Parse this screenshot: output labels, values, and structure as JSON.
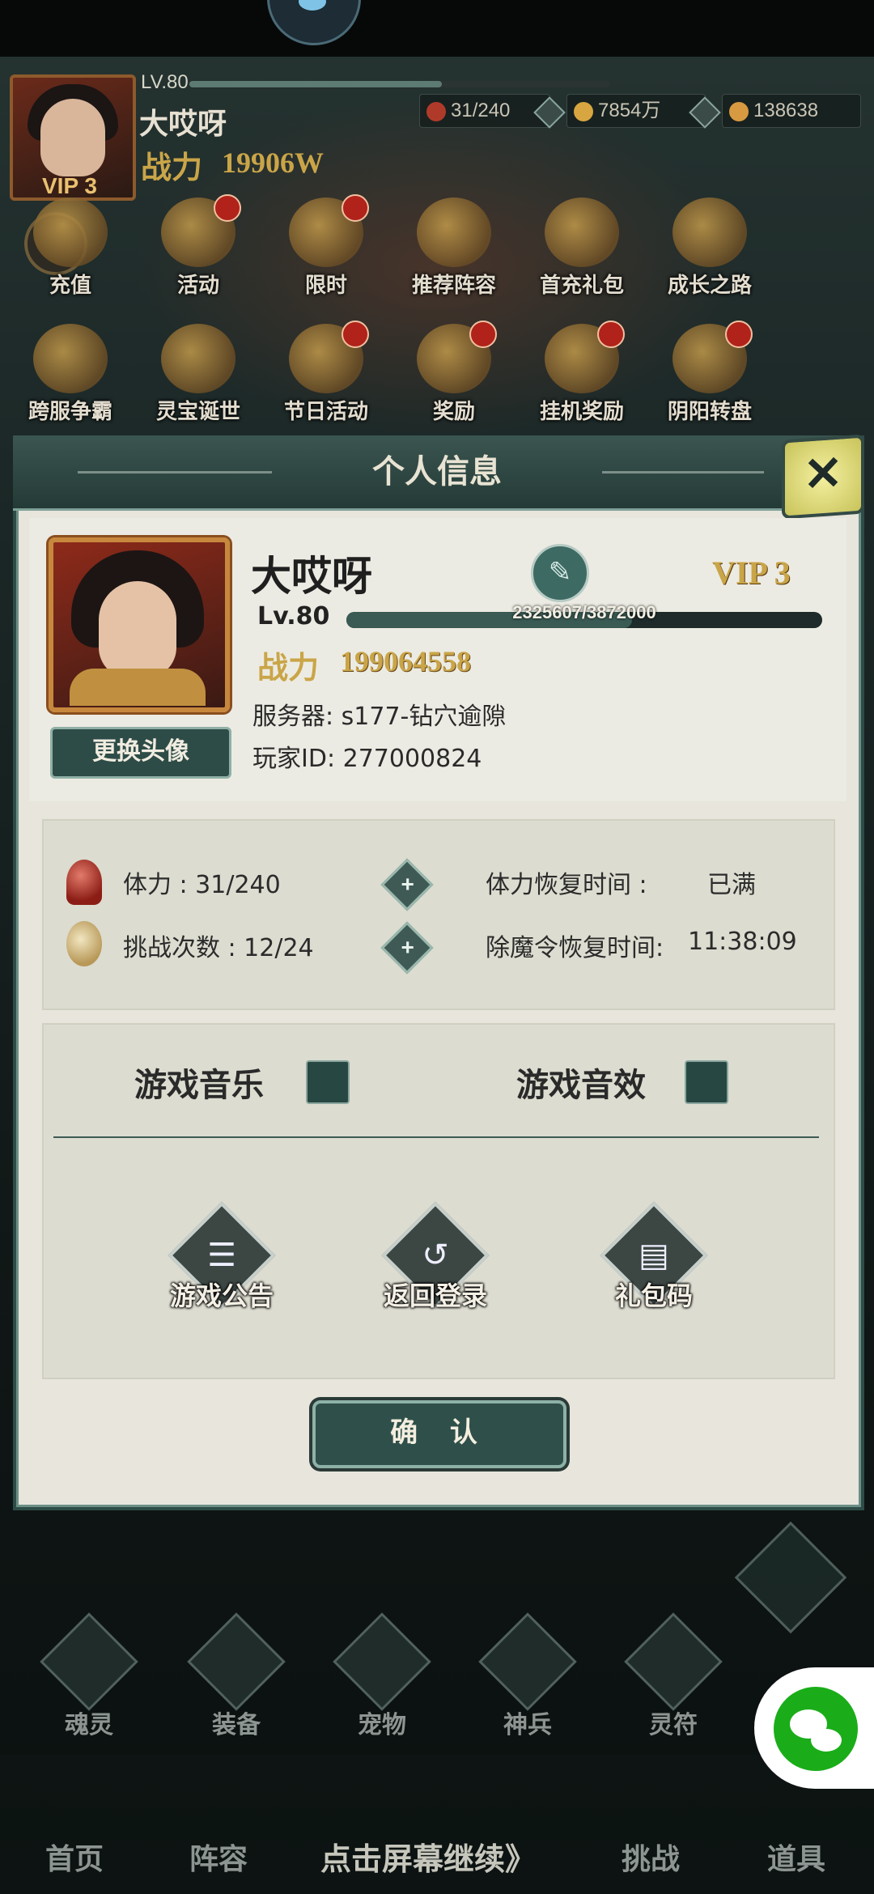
{
  "header": {
    "level": "LV.80",
    "player_name": "大哎呀",
    "power_label": "战力",
    "power_value": "19906W",
    "vip": "VIP 3",
    "level_progress": 0.6,
    "resources": [
      {
        "value": "31/240",
        "icon": "stamina-orb-icon",
        "color": "#b03a2a"
      },
      {
        "value": "7854万",
        "icon": "gold-coin-icon",
        "color": "#d7a640"
      },
      {
        "value": "138638",
        "icon": "ingot-icon",
        "color": "#d79a40"
      }
    ]
  },
  "activities_row1": [
    {
      "label": "充值",
      "badge": false
    },
    {
      "label": "活动",
      "badge": true
    },
    {
      "label": "限时",
      "badge": true
    },
    {
      "label": "推荐阵容",
      "badge": false
    },
    {
      "label": "首充礼包",
      "badge": false
    },
    {
      "label": "成长之路",
      "badge": false
    }
  ],
  "activities_row2": [
    {
      "label": "跨服争霸",
      "badge": false
    },
    {
      "label": "灵宝诞世",
      "badge": false
    },
    {
      "label": "节日活动",
      "badge": true
    },
    {
      "label": "奖励",
      "badge": true
    },
    {
      "label": "挂机奖励",
      "badge": true
    },
    {
      "label": "阴阳转盘",
      "badge": true
    }
  ],
  "modal": {
    "title": "个人信息",
    "close_icon": "close-x-icon",
    "profile": {
      "name": "大哎呀",
      "vip": "VIP 3",
      "level": "Lv.80",
      "exp_text": "2325607/3872000",
      "exp_current": 2325607,
      "exp_max": 3872000,
      "power_label": "战力",
      "power_value": "199064558",
      "server_label": "服务器:",
      "server_value": "s177-钻穴逾隙",
      "id_label": "玩家ID:",
      "id_value": "277000824",
      "change_avatar": "更换头像"
    },
    "stamina": {
      "stamina_label": "体力 : 31/240",
      "challenge_label": "挑战次数 : 12/24",
      "stamina_recover_label": "体力恢复时间 :",
      "stamina_recover_value": "已满",
      "token_recover_label": "除魔令恢复时间:",
      "token_recover_value": "11:38:09"
    },
    "settings": {
      "music_label": "游戏音乐",
      "sfx_label": "游戏音效",
      "music_on": false,
      "sfx_on": false
    },
    "actions": [
      {
        "label": "游戏公告",
        "icon": "notice-icon",
        "glyph": "☰"
      },
      {
        "label": "返回登录",
        "icon": "return-icon",
        "glyph": "↺"
      },
      {
        "label": "礼包码",
        "icon": "gift-code-icon",
        "glyph": "▤"
      }
    ],
    "confirm": "确 认"
  },
  "background_menu": [
    {
      "label": "魂灵"
    },
    {
      "label": "装备"
    },
    {
      "label": "宠物"
    },
    {
      "label": "神兵"
    },
    {
      "label": "灵符"
    }
  ],
  "bottom_nav": {
    "items": [
      "首页",
      "阵容",
      "挑战",
      "道具"
    ],
    "continue_text": "点击屏幕继续》"
  },
  "colors": {
    "accent_gold": "#caa548",
    "panel_green": "#2e4c47",
    "badge_red": "#b0221a"
  }
}
